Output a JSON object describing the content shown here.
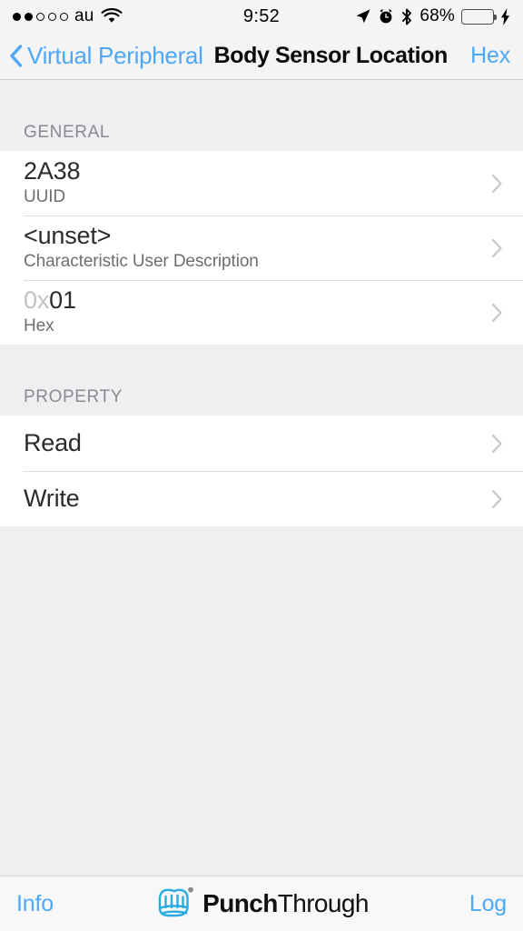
{
  "status_bar": {
    "signal_filled": 2,
    "signal_total": 5,
    "carrier": "au",
    "wifi_icon": "wifi-icon",
    "time": "9:52",
    "location_icon": "location-arrow-icon",
    "alarm_icon": "alarm-clock-icon",
    "bluetooth_icon": "bluetooth-icon",
    "battery_percent": "68%",
    "battery_level": 68,
    "battery_color": "#4CD964",
    "charging_icon": "lightning-bolt-icon"
  },
  "navbar": {
    "back_icon": "chevron-left-icon",
    "back_label": "Virtual Peripheral",
    "title": "Body Sensor Location",
    "right_button": "Hex",
    "tint_color": "#4DA8F7"
  },
  "sections": [
    {
      "header": "GENERAL",
      "rows": [
        {
          "value": "2A38",
          "prefix": "",
          "subtitle": "UUID",
          "accessory": "chevron-right-icon"
        },
        {
          "value": "<unset>",
          "prefix": "",
          "subtitle": "Characteristic User Description",
          "accessory": "chevron-right-icon"
        },
        {
          "value": "01",
          "prefix": "0x",
          "subtitle": "Hex",
          "accessory": "chevron-right-icon"
        }
      ]
    },
    {
      "header": "PROPERTY",
      "rows": [
        {
          "value": "Read",
          "prefix": "",
          "subtitle": "",
          "accessory": "chevron-right-icon"
        },
        {
          "value": "Write",
          "prefix": "",
          "subtitle": "",
          "accessory": "chevron-right-icon"
        }
      ]
    }
  ],
  "toolbar": {
    "left_button": "Info",
    "right_button": "Log",
    "brand_mark": "punchthrough-fist-logo",
    "brand_bold": "Punch",
    "brand_light": "Through",
    "brand_registered": "®"
  }
}
